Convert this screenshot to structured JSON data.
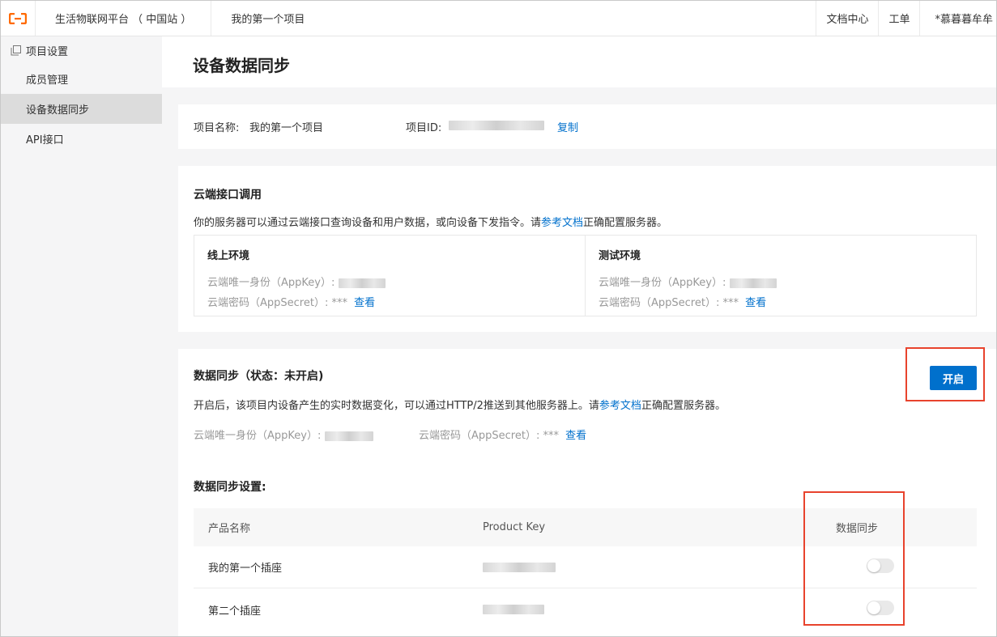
{
  "topbar": {
    "platform": "生活物联网平台 （ 中国站 ）",
    "project": "我的第一个项目",
    "docs": "文档中心",
    "ticket": "工单",
    "user": "*慕暮暮牟牟",
    "accent": "#ff6a00"
  },
  "sidebar": {
    "group": "项目设置",
    "items": [
      {
        "label": "成员管理"
      },
      {
        "label": "设备数据同步"
      },
      {
        "label": "API接口"
      }
    ]
  },
  "page": {
    "title": "设备数据同步"
  },
  "project_info": {
    "name_label": "项目名称:",
    "name_value": "我的第一个项目",
    "id_label": "项目ID:",
    "copy": "复制"
  },
  "cloud_api": {
    "title": "云端接口调用",
    "desc_prefix": "你的服务器可以通过云端接口查询设备和用户数据，或向设备下发指令。请",
    "desc_link": "参考文档",
    "desc_suffix": "正确配置服务器。",
    "online": {
      "title": "线上环境",
      "appkey_label": "云端唯一身份（AppKey）:",
      "secret_label": "云端密码（AppSecret）:",
      "secret_mask": "***",
      "view": "查看"
    },
    "test": {
      "title": "测试环境",
      "appkey_label": "云端唯一身份（AppKey）:",
      "secret_label": "云端密码（AppSecret）:",
      "secret_mask": "***",
      "view": "查看"
    }
  },
  "data_sync": {
    "title": "数据同步（状态：未开启)",
    "enable": "开启",
    "desc_prefix": "开启后，该项目内设备产生的实时数据变化，可以通过HTTP/2推送到其他服务器上。请",
    "desc_link": "参考文档",
    "desc_suffix": "正确配置服务器。",
    "appkey_label": "云端唯一身份（AppKey）:",
    "secret_label": "云端密码（AppSecret）:",
    "secret_mask": "***",
    "view": "查看",
    "settings_title": "数据同步设置:",
    "columns": [
      "产品名称",
      "Product Key",
      "数据同步"
    ],
    "rows": [
      {
        "name": "我的第一个插座"
      },
      {
        "name": "第二个插座"
      }
    ]
  }
}
